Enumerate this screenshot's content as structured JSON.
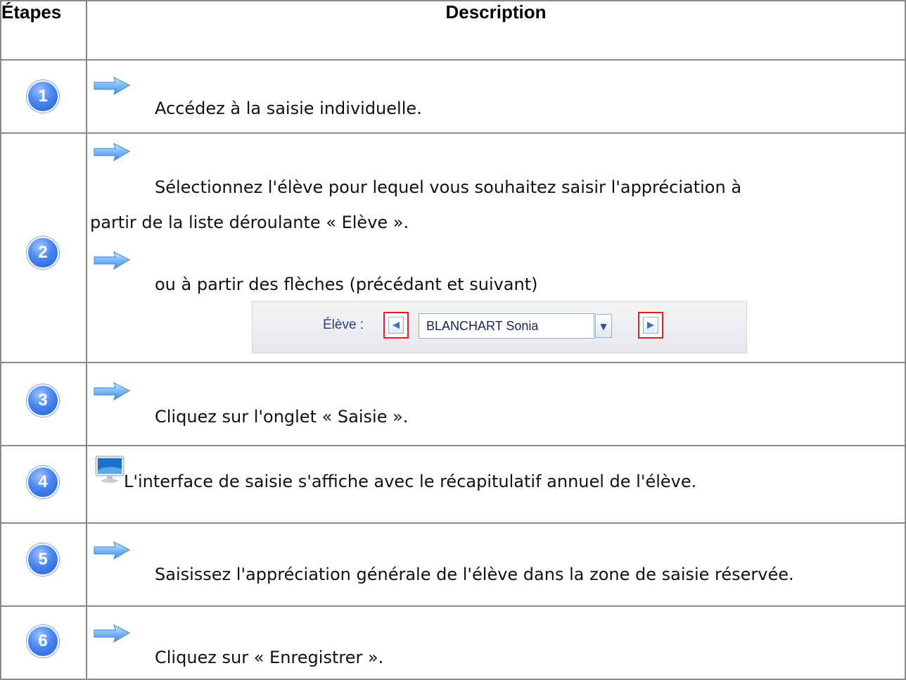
{
  "table": {
    "header": {
      "step": "Étapes",
      "description": "Description"
    }
  },
  "rows": [
    {
      "number": "1",
      "lines": [
        "Accédez à la saisie individuelle."
      ]
    },
    {
      "number": "2",
      "lines": [
        "Sélectionnez l'élève pour lequel vous souhaitez saisir l'appréciation à",
        "partir de la liste déroulante « Elève ».",
        "ou  à partir des flèches (précédant et suivant)"
      ],
      "widget": {
        "label": "Élève :",
        "selected": "BLANCHART Sonia"
      }
    },
    {
      "number": "3",
      "lines": [
        "Cliquez sur l'onglet « Saisie »."
      ]
    },
    {
      "number": "4",
      "lines": [
        "L'interface de saisie s'affiche avec le récapitulatif annuel de l'élève."
      ]
    },
    {
      "number": "5",
      "lines": [
        "Saisissez l'appréciation générale de l'élève dans la zone de saisie réservée."
      ]
    },
    {
      "number": "6",
      "lines": [
        "Cliquez sur « Enregistrer »."
      ]
    }
  ],
  "icons": {
    "step_marker": "arrow-icon",
    "screen_marker": "monitor-icon",
    "badge": "number-badge-icon"
  },
  "colors": {
    "badge": "#4a86f0",
    "arrow": "#7ab8f5",
    "highlight": "#e02020",
    "border": "#8a8a8a"
  }
}
